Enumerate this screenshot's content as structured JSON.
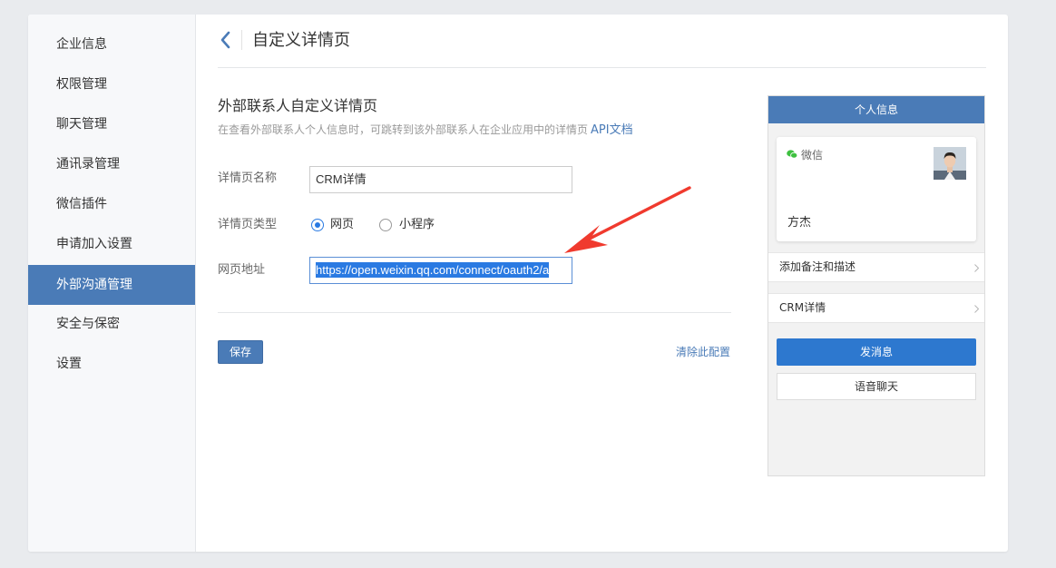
{
  "sidebar": {
    "items": [
      {
        "label": "企业信息"
      },
      {
        "label": "权限管理"
      },
      {
        "label": "聊天管理"
      },
      {
        "label": "通讯录管理"
      },
      {
        "label": "微信插件"
      },
      {
        "label": "申请加入设置"
      },
      {
        "label": "外部沟通管理",
        "active": true
      },
      {
        "label": "安全与保密"
      },
      {
        "label": "设置"
      }
    ]
  },
  "header": {
    "title": "自定义详情页",
    "back_icon": "chevron-left-icon"
  },
  "section": {
    "title": "外部联系人自定义详情页",
    "description": "在查看外部联系人个人信息时，可跳转到该外部联系人在企业应用中的详情页",
    "doc_link": "API文档"
  },
  "form": {
    "name_label": "详情页名称",
    "name_value": "CRM详情",
    "type_label": "详情页类型",
    "type_options": [
      {
        "label": "网页",
        "selected": true
      },
      {
        "label": "小程序",
        "selected": false
      }
    ],
    "url_label": "网页地址",
    "url_value": "https://open.weixin.qq.com/connect/oauth2/a",
    "save_label": "保存",
    "clear_label": "清除此配置"
  },
  "preview": {
    "header": "个人信息",
    "wechat_label": "微信",
    "contact_name": "方杰",
    "rows": [
      {
        "label": "添加备注和描述"
      },
      {
        "label": "CRM详情"
      }
    ],
    "send_label": "发消息",
    "voice_label": "语音聊天"
  },
  "colors": {
    "accent": "#4a7bb7",
    "primary_button": "#2d78cf",
    "annotation_arrow": "#f03a2e",
    "wechat_green": "#3ec040"
  }
}
